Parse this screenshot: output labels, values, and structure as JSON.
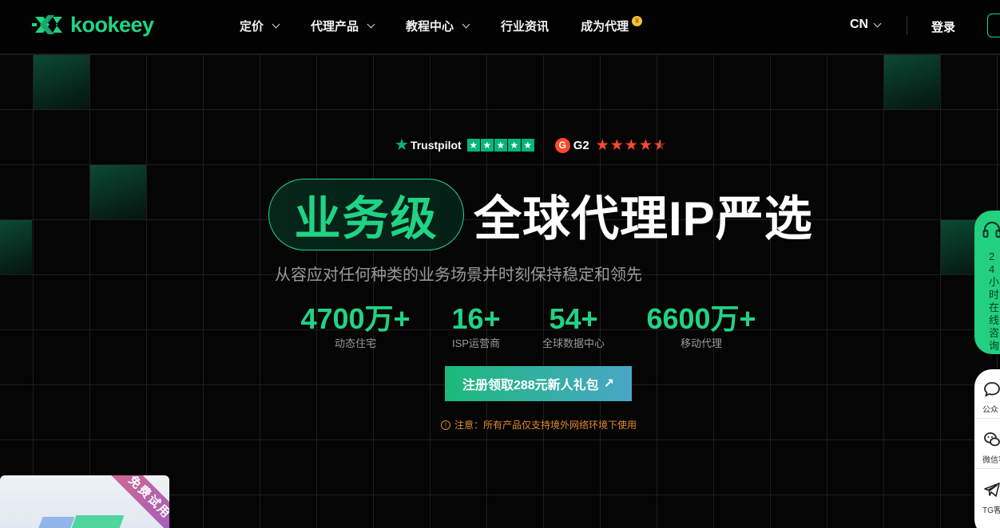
{
  "brand": {
    "name": "kookeey",
    "accent": "#21d384"
  },
  "nav": {
    "items": [
      {
        "label": "定价",
        "dropdown": true
      },
      {
        "label": "代理产品",
        "dropdown": true
      },
      {
        "label": "教程中心",
        "dropdown": true
      },
      {
        "label": "行业资讯",
        "dropdown": false
      },
      {
        "label": "成为代理",
        "dropdown": false,
        "badge": "coin-icon"
      }
    ],
    "language": "CN",
    "login": "登录"
  },
  "ratings": {
    "trustpilot_label": "Trustpilot",
    "g2_label": "G2"
  },
  "hero": {
    "pill": "业务级",
    "title_rest": "全球代理IP严选",
    "subtitle": "从容应对任何种类的业务场景并时刻保持稳定和领先"
  },
  "stats": [
    {
      "value": "4700万+",
      "label": "动态住宅"
    },
    {
      "value": "16+",
      "label": "ISP运营商"
    },
    {
      "value": "54+",
      "label": "全球数据中心"
    },
    {
      "value": "6600万+",
      "label": "移动代理"
    }
  ],
  "cta": {
    "label": "注册领取288元新人礼包",
    "arrow": "↗"
  },
  "notice": {
    "icon": "!",
    "text": "注意：所有产品仅支持境外网络环境下使用"
  },
  "trial": {
    "ribbon": "免费试用"
  },
  "support": {
    "text": "24小时在线咨询"
  },
  "side_panel": [
    {
      "label": "公众",
      "icon": "chat-icon"
    },
    {
      "label": "微信客",
      "icon": "wechat-icon"
    },
    {
      "label": "TG客",
      "icon": "telegram-icon"
    }
  ]
}
